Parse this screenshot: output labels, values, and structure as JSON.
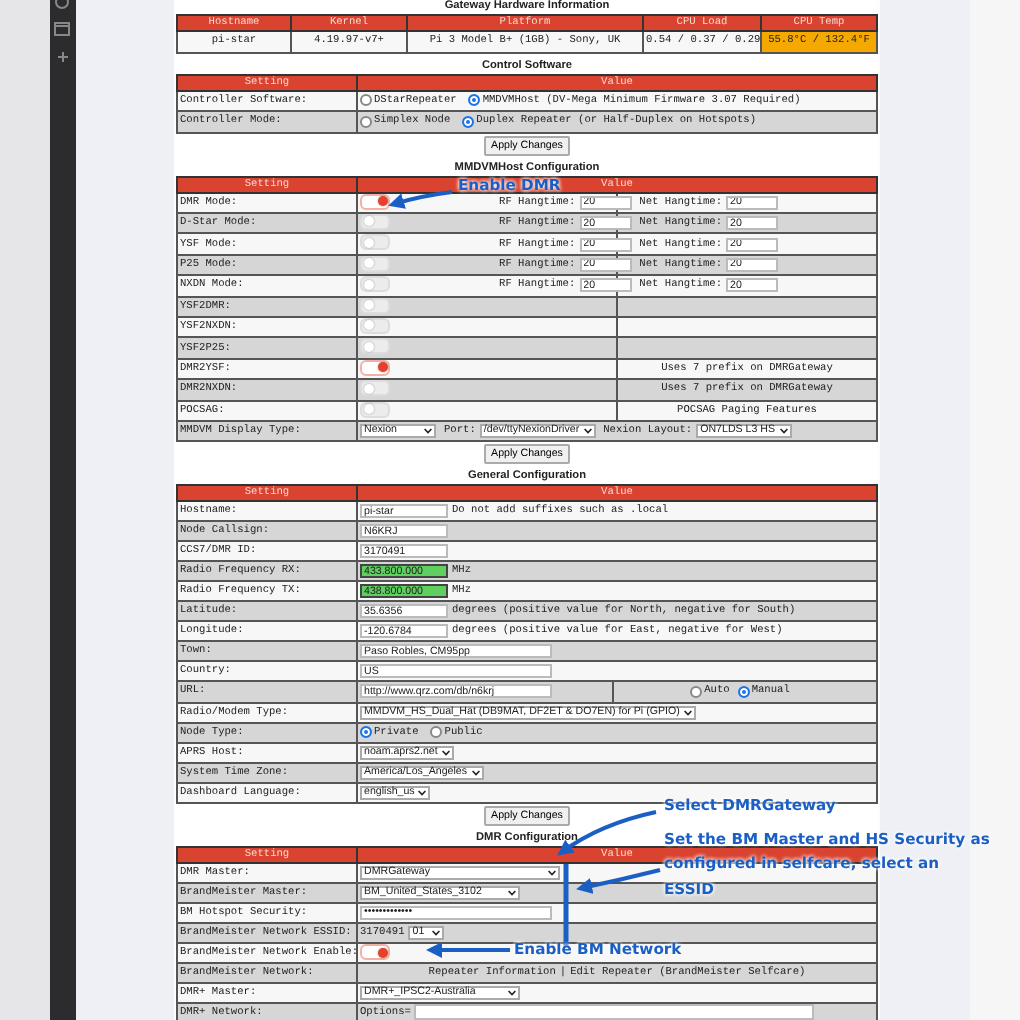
{
  "hardware": {
    "title": "Gateway Hardware Information",
    "columns": [
      "Hostname",
      "Kernel",
      "Platform",
      "CPU Load",
      "CPU Temp"
    ],
    "cells": [
      {
        "text": "pi-star"
      },
      {
        "text": "4.19.97-v7+"
      },
      {
        "text": "Pi 3 Model B+ (1GB) - Sony, UK"
      },
      {
        "text": "0.54 / 0.37 / 0.29"
      },
      {
        "text": "55.8°C / 132.4°F",
        "color": "#f5a800"
      }
    ]
  },
  "control": {
    "title": "Control Software",
    "columns": [
      "Setting",
      "Value"
    ],
    "rows": [
      {
        "label": "Controller Software:",
        "options": [
          {
            "label": "DStarRepeater",
            "selected": false
          },
          {
            "label": "MMDVMHost (DV-Mega Minimum Firmware 3.07 Required)",
            "selected": true
          }
        ]
      },
      {
        "label": "Controller Mode:",
        "options": [
          {
            "label": "Simplex Node",
            "selected": false
          },
          {
            "label": "Duplex Repeater (or Half-Duplex on Hotspots)",
            "selected": true
          }
        ]
      }
    ],
    "button": "Apply Changes"
  },
  "mmdvm": {
    "title": "MMDVMHost Configuration",
    "columns": [
      "Setting",
      "Value"
    ],
    "rows": [
      {
        "kind": "mode",
        "label": "DMR Mode:",
        "on": true,
        "rf_label": "RF Hangtime:",
        "rf_value": "20",
        "net_label": "Net Hangtime:",
        "net_value": "20"
      },
      {
        "kind": "mode",
        "label": "D-Star Mode:",
        "on": false,
        "rf_label": "RF Hangtime:",
        "rf_value": "20",
        "net_label": "Net Hangtime:",
        "net_value": "20"
      },
      {
        "kind": "mode",
        "label": "YSF Mode:",
        "on": false,
        "rf_label": "RF Hangtime:",
        "rf_value": "20",
        "net_label": "Net Hangtime:",
        "net_value": "20"
      },
      {
        "kind": "mode",
        "label": "P25 Mode:",
        "on": false,
        "rf_label": "RF Hangtime:",
        "rf_value": "20",
        "net_label": "Net Hangtime:",
        "net_value": "20"
      },
      {
        "kind": "mode",
        "label": "NXDN Mode:",
        "on": false,
        "rf_label": "RF Hangtime:",
        "rf_value": "20",
        "net_label": "Net Hangtime:",
        "net_value": "20"
      },
      {
        "kind": "toggle",
        "label": "YSF2DMR:",
        "on": false
      },
      {
        "kind": "toggle",
        "label": "YSF2NXDN:",
        "on": false
      },
      {
        "kind": "toggle",
        "label": "YSF2P25:",
        "on": false
      },
      {
        "kind": "toggle",
        "label": "DMR2YSF:",
        "on": true,
        "note": "Uses 7 prefix on DMRGateway"
      },
      {
        "kind": "toggle",
        "label": "DMR2NXDN:",
        "on": false,
        "note": "Uses 7 prefix on DMRGateway"
      },
      {
        "kind": "toggle",
        "label": "POCSAG:",
        "on": false,
        "note": "POCSAG Paging Features"
      },
      {
        "kind": "display",
        "label": "MMDVM Display Type:",
        "type": "Nexion",
        "port_label": "Port:",
        "port": "/dev/ttyNexionDriver",
        "layout_label": "Nexion Layout:",
        "layout": "ON7LDS L3 HS"
      }
    ],
    "button": "Apply Changes"
  },
  "general": {
    "title": "General Configuration",
    "columns": [
      "Setting",
      "Value"
    ],
    "rows": [
      {
        "kind": "input",
        "label": "Hostname:",
        "value": "pi-star",
        "note": "Do not add suffixes such as .local",
        "highlighted": false
      },
      {
        "kind": "input",
        "label": "Node Callsign:",
        "value": "N6KRJ",
        "highlighted": false
      },
      {
        "kind": "input",
        "label": "CCS7/DMR ID:",
        "value": "3170491",
        "highlighted": false
      },
      {
        "kind": "input",
        "label": "Radio Frequency RX:",
        "value": "433.800.000",
        "note": "MHz",
        "highlighted": true
      },
      {
        "kind": "input",
        "label": "Radio Frequency TX:",
        "value": "438.800.000",
        "note": "MHz",
        "highlighted": true
      },
      {
        "kind": "input",
        "label": "Latitude:",
        "value": "35.6356",
        "note": "degrees (positive value for North, negative for South)",
        "highlighted": false
      },
      {
        "kind": "input",
        "label": "Longitude:",
        "value": "-120.6784",
        "note": "degrees (positive value for East, negative for West)",
        "highlighted": false
      },
      {
        "kind": "wide",
        "label": "Town:",
        "value": "Paso Robles, CM95pp"
      },
      {
        "kind": "wide",
        "label": "Country:",
        "value": "US"
      },
      {
        "kind": "url",
        "label": "URL:",
        "value": "http://www.qrz.com/db/n6krj",
        "options": [
          {
            "label": "Auto",
            "selected": false
          },
          {
            "label": "Manual",
            "selected": true
          }
        ]
      },
      {
        "kind": "select",
        "label": "Radio/Modem Type:",
        "value": "MMDVM_HS_Dual_Hat (DB9MAT, DF2ET & DO7EN) for Pi (GPIO)"
      },
      {
        "kind": "radio",
        "label": "Node Type:",
        "options": [
          {
            "label": "Private",
            "selected": true
          },
          {
            "label": "Public",
            "selected": false
          }
        ]
      },
      {
        "kind": "select",
        "label": "APRS Host:",
        "value": "noam.aprs2.net"
      },
      {
        "kind": "select",
        "label": "System Time Zone:",
        "value": "America/Los_Angeles"
      },
      {
        "kind": "select",
        "label": "Dashboard Language:",
        "value": "english_us"
      }
    ],
    "button": "Apply Changes"
  },
  "dmr": {
    "title": "DMR Configuration",
    "columns": [
      "Setting",
      "Value"
    ],
    "rows": [
      {
        "kind": "select",
        "label": "DMR Master:",
        "value": "DMRGateway"
      },
      {
        "kind": "select",
        "label": "BrandMeister Master:",
        "value": "BM_United_States_3102"
      },
      {
        "kind": "wide",
        "label": "BM Hotspot Security:",
        "value": "•••••••••••••"
      },
      {
        "kind": "essid",
        "label": "BrandMeister Network ESSID:",
        "prefix": "3170491",
        "value": "01"
      },
      {
        "kind": "toggle",
        "label": "BrandMeister Network Enable:",
        "on": true
      },
      {
        "kind": "links",
        "label": "BrandMeister Network:",
        "links": [
          "Repeater Information",
          "Edit Repeater (BrandMeister Selfcare)"
        ],
        "separator": "|"
      },
      {
        "kind": "select",
        "label": "DMR+ Master:",
        "value": "DMR+_IPSC2-Australia"
      },
      {
        "kind": "options",
        "label": "DMR+ Network:",
        "prefix": "Options="
      }
    ]
  },
  "annotations": [
    {
      "text": "Enable DMR"
    },
    {
      "text": "Select DMRGateway"
    },
    {
      "text": "Set the BM Master and HS Security as configured in selfcare, select an ESSID"
    },
    {
      "text": "Enable BM Network"
    }
  ]
}
